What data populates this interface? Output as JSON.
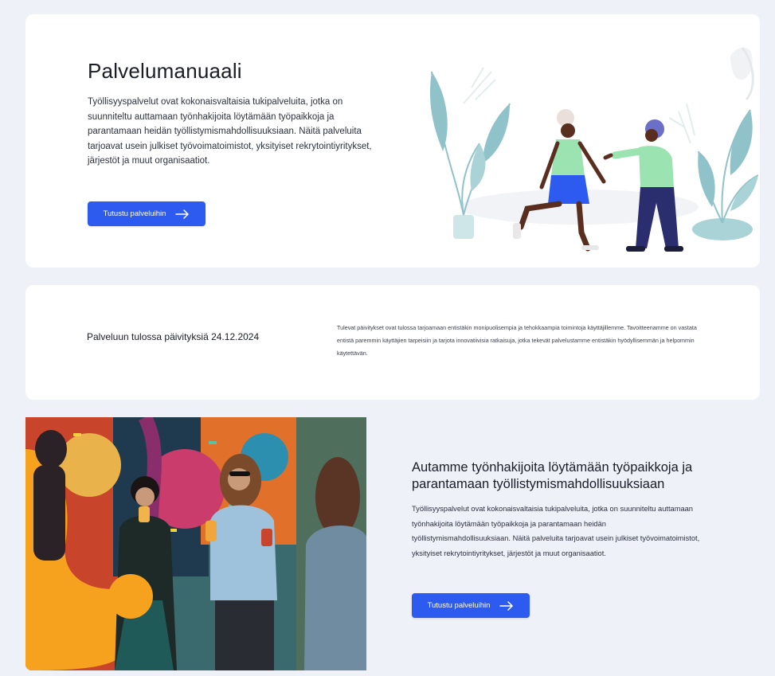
{
  "hero": {
    "title": "Palvelumanuaali",
    "description": "Työllisyyspalvelut ovat kokonaisvaltaisia tukipalveluita, jotka on suunniteltu auttamaan työnhakijoita löytämään työpaikkoja ja parantamaan heidän työllistymismahdollisuuksiaan. Näitä palveluita tarjoavat usein julkiset työvoimatoimistot, yksityiset rekrytointiyritykset, järjestöt ja muut organisaatiot.",
    "button_label": "Tutustu palveluihin"
  },
  "update": {
    "title": "Palveluun tulossa päivityksiä 24.12.2024",
    "description": "Tulevat päivitykset ovat tulossa tarjoamaan entistäkin monipuolisempia ja tehokkaampia toimintoja käyttäjillemme. Tavoitteenamme on vastata entistä paremmin käyttäjien tarpeisiin ja tarjota innovatiivisia ratkaisuja, jotka tekevät palvelustamme entistäkin hyödyllisemmän ja helpommin käytettävän."
  },
  "feature": {
    "title": "Autamme työnhakijoita löytämään työpaikkoja ja parantamaan työllistymismahdollisuuksiaan",
    "description": "Työllisyyspalvelut ovat kokonaisvaltaisia tukipalveluita, jotka on suunniteltu auttamaan työnhakijoita löytämään työpaikkoja ja parantamaan heidän työllistymismahdollisuuksiaan. Näitä palveluita tarjoavat usein julkiset työvoimatoimistot, yksityiset rekrytointiyritykset, järjestöt ja muut organisaatiot.",
    "button_label": "Tutustu palveluihin"
  },
  "colors": {
    "page_background": "#eef1f8",
    "card_background": "#ffffff",
    "accent": "#2d5bf0",
    "illustration_teal": "#8fc3c9",
    "illustration_green": "#9be3b0",
    "photo_orange": "#f6a21e"
  },
  "icons": {
    "button_arrow": "arrow-right-icon"
  }
}
